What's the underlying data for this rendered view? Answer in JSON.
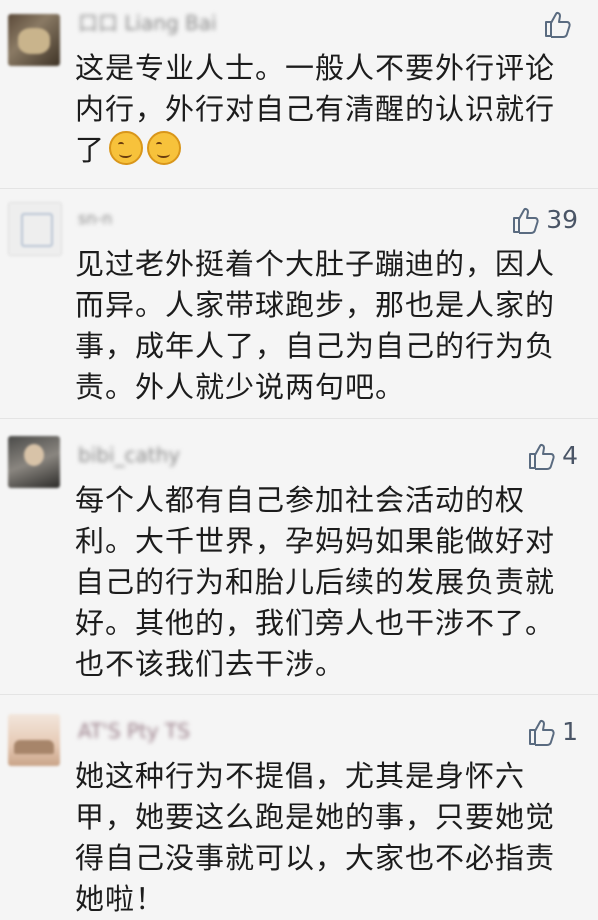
{
  "comments": [
    {
      "author": "口口 Liang Bai",
      "likes": "",
      "lines": [
        "这是专业人士。一般人不要外行评论",
        "内行，外行对自己有清醒的认识就行",
        "了"
      ],
      "emoji": [
        "thinking-face",
        "thinking-face"
      ]
    },
    {
      "author": "sn-n",
      "likes": "39",
      "lines": [
        "见过老外挺着个大肚子蹦迪的，因人",
        "而异。人家带球跑步，那也是人家的",
        "事，成年人了，自己为自己的行为负",
        "责。外人就少说两句吧。"
      ]
    },
    {
      "author": "bibi_cathy",
      "likes": "4",
      "lines": [
        "每个人都有自己参加社会活动的权",
        "利。大千世界，孕妈妈如果能做好对",
        "自己的行为和胎儿后续的发展负责就",
        "好。其他的，我们旁人也干涉不了。",
        "也不该我们去干涉。"
      ]
    },
    {
      "author": "AT'S Pty TS",
      "likes": "1",
      "lines": [
        "她这种行为不提倡，尤其是身怀六",
        "甲，她要这么跑是她的事，只要她觉",
        "得自己没事就可以，大家也不必指责",
        "她啦！"
      ]
    }
  ],
  "icons": {
    "like": "thumbs-up-icon",
    "emoji": "thinking-face-icon"
  },
  "colors": {
    "background": "#f5f5f5",
    "text": "#1c1c1c",
    "author": "#8c8c8c",
    "like": "#5a6b80"
  }
}
